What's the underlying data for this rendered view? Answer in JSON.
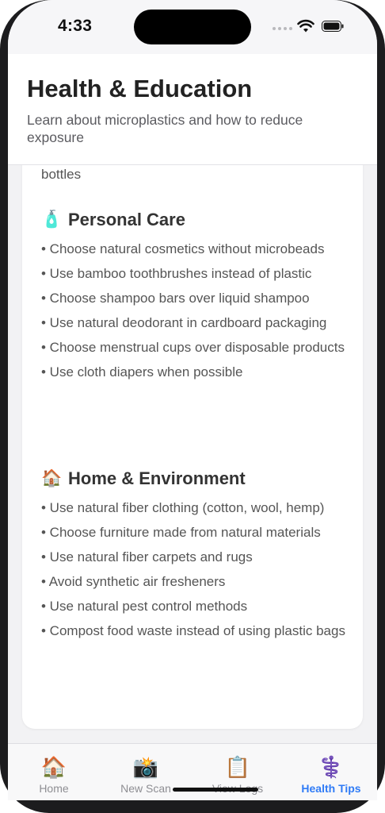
{
  "status": {
    "time": "4:33"
  },
  "header": {
    "title": "Health & Education",
    "subtitle": "Learn about microplastics and how to reduce exposure"
  },
  "content": {
    "overflow_text": "bottles",
    "sections": [
      {
        "icon": "🧴",
        "title": "Personal Care",
        "tips": [
          "• Choose natural cosmetics without microbeads",
          "• Use bamboo toothbrushes instead of plastic",
          "• Choose shampoo bars over liquid shampoo",
          "• Use natural deodorant in cardboard packaging",
          "• Choose menstrual cups over disposable products",
          "• Use cloth diapers when possible"
        ]
      },
      {
        "icon": "🏠",
        "title": "Home & Environment",
        "tips": [
          "• Use natural fiber clothing (cotton, wool, hemp)",
          "• Choose furniture made from natural materials",
          "• Use natural fiber carpets and rugs",
          "• Avoid synthetic air fresheners",
          "• Use natural pest control methods",
          "• Compost food waste instead of using plastic bags"
        ]
      }
    ]
  },
  "tabs": [
    {
      "icon": "🏠",
      "label": "Home",
      "active": false
    },
    {
      "icon": "📸",
      "label": "New Scan",
      "active": false
    },
    {
      "icon": "📋",
      "label": "View Logs",
      "active": false
    },
    {
      "icon": "⚕️",
      "label": "Health Tips",
      "active": true
    }
  ],
  "colors": {
    "accent": "#2f7bf6"
  }
}
